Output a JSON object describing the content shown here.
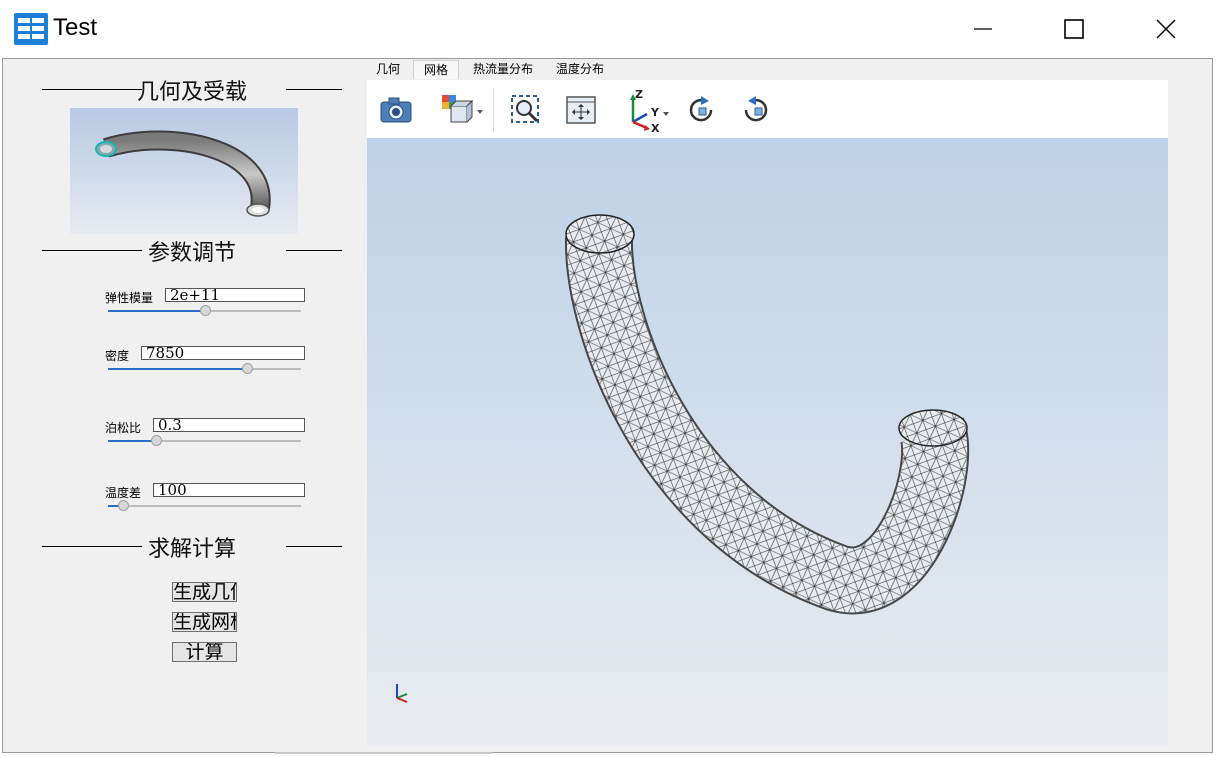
{
  "window": {
    "title": "Test"
  },
  "icons": {
    "app": "app-logo-icon",
    "minimize": "minimize-icon",
    "maximize": "maximize-icon",
    "close": "close-icon"
  },
  "left_panel": {
    "geometry_section": {
      "title": "几何及受载"
    },
    "params_section": {
      "title": "参数调节",
      "params": [
        {
          "label": "弹性模量",
          "value": "2e+11",
          "slider_fraction": 0.5
        },
        {
          "label": "密度",
          "value": "7850",
          "slider_fraction": 0.72
        },
        {
          "label": "泊松比",
          "value": "0.3",
          "slider_fraction": 0.25
        },
        {
          "label": "温度差",
          "value": "100",
          "slider_fraction": 0.08
        }
      ]
    },
    "solve_section": {
      "title": "求解计算",
      "buttons": [
        "生成几何",
        "生成网格",
        "计算"
      ]
    }
  },
  "tabs": [
    {
      "label": "几何",
      "active": false
    },
    {
      "label": "网格",
      "active": true
    },
    {
      "label": "热流量分布",
      "active": false
    },
    {
      "label": "温度分布",
      "active": false
    }
  ],
  "toolbar": {
    "buttons": [
      "camera-icon",
      "view-cube-icon",
      "zoom-box-icon",
      "fit-all-icon",
      "axis-orientation-icon",
      "rotate-cw-icon",
      "rotate-ccw-icon"
    ],
    "axis_labels": {
      "z": "Z",
      "y": "Y",
      "x": "X"
    }
  },
  "colors": {
    "accent": "#2a6fc8",
    "viewport_top": "#bdd1e7",
    "viewport_bottom": "#e9ecf0"
  }
}
